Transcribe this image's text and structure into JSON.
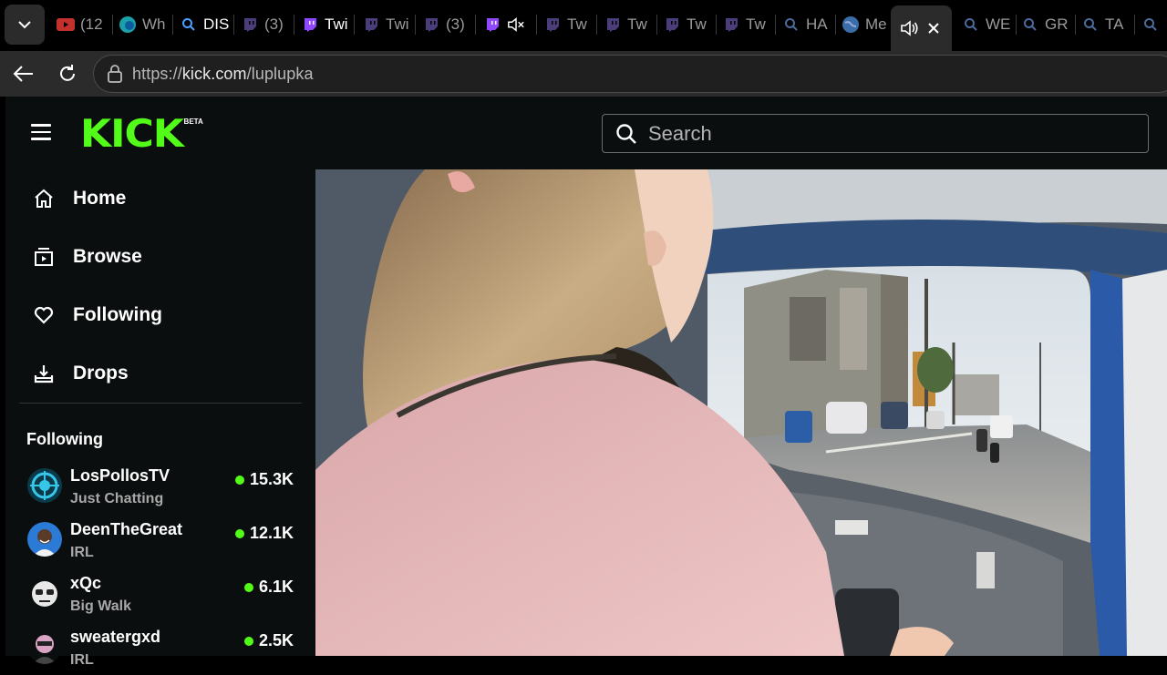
{
  "browser": {
    "tabs": [
      {
        "label": "(12",
        "icon": "youtube-icon"
      },
      {
        "label": "Wh",
        "icon": "edge-icon"
      },
      {
        "label": "DIS",
        "icon": "search-icon"
      },
      {
        "label": "(3)",
        "icon": "twitch-icon"
      },
      {
        "label": "Twi",
        "icon": "twitch-icon"
      },
      {
        "label": "Twi",
        "icon": "twitch-icon"
      },
      {
        "label": "(3)",
        "icon": "twitch-icon"
      },
      {
        "label": "",
        "icon": "twitch-icon"
      },
      {
        "label": "Tw",
        "icon": "twitch-icon"
      },
      {
        "label": "Tw",
        "icon": "twitch-icon"
      },
      {
        "label": "Tw",
        "icon": "twitch-icon"
      },
      {
        "label": "Tw",
        "icon": "twitch-icon"
      },
      {
        "label": "HA",
        "icon": "search-icon"
      },
      {
        "label": "Me",
        "icon": "globe-icon"
      },
      {
        "label": "WE",
        "icon": "search-icon"
      },
      {
        "label": "GR",
        "icon": "search-icon"
      },
      {
        "label": "TA",
        "icon": "search-icon"
      }
    ],
    "url_prefix": "https://",
    "url_host": "kick.com",
    "url_path": "/luplupka"
  },
  "site": {
    "logo_text": "KICK",
    "logo_badge": "BETA",
    "search_placeholder": "Search",
    "brand_color": "#53fc18"
  },
  "sidebar": {
    "nav": [
      {
        "label": "Home",
        "icon": "home-icon"
      },
      {
        "label": "Browse",
        "icon": "browse-icon"
      },
      {
        "label": "Following",
        "icon": "heart-icon"
      },
      {
        "label": "Drops",
        "icon": "drops-icon"
      }
    ],
    "following_heading": "Following",
    "channels": [
      {
        "name": "LosPollosTV",
        "category": "Just Chatting",
        "viewers": "15.3K"
      },
      {
        "name": "DeenTheGreat",
        "category": "IRL",
        "viewers": "12.1K"
      },
      {
        "name": "xQc",
        "category": "Big Walk",
        "viewers": "6.1K"
      },
      {
        "name": "sweatergxd",
        "category": "IRL",
        "viewers": "2.5K"
      }
    ]
  }
}
